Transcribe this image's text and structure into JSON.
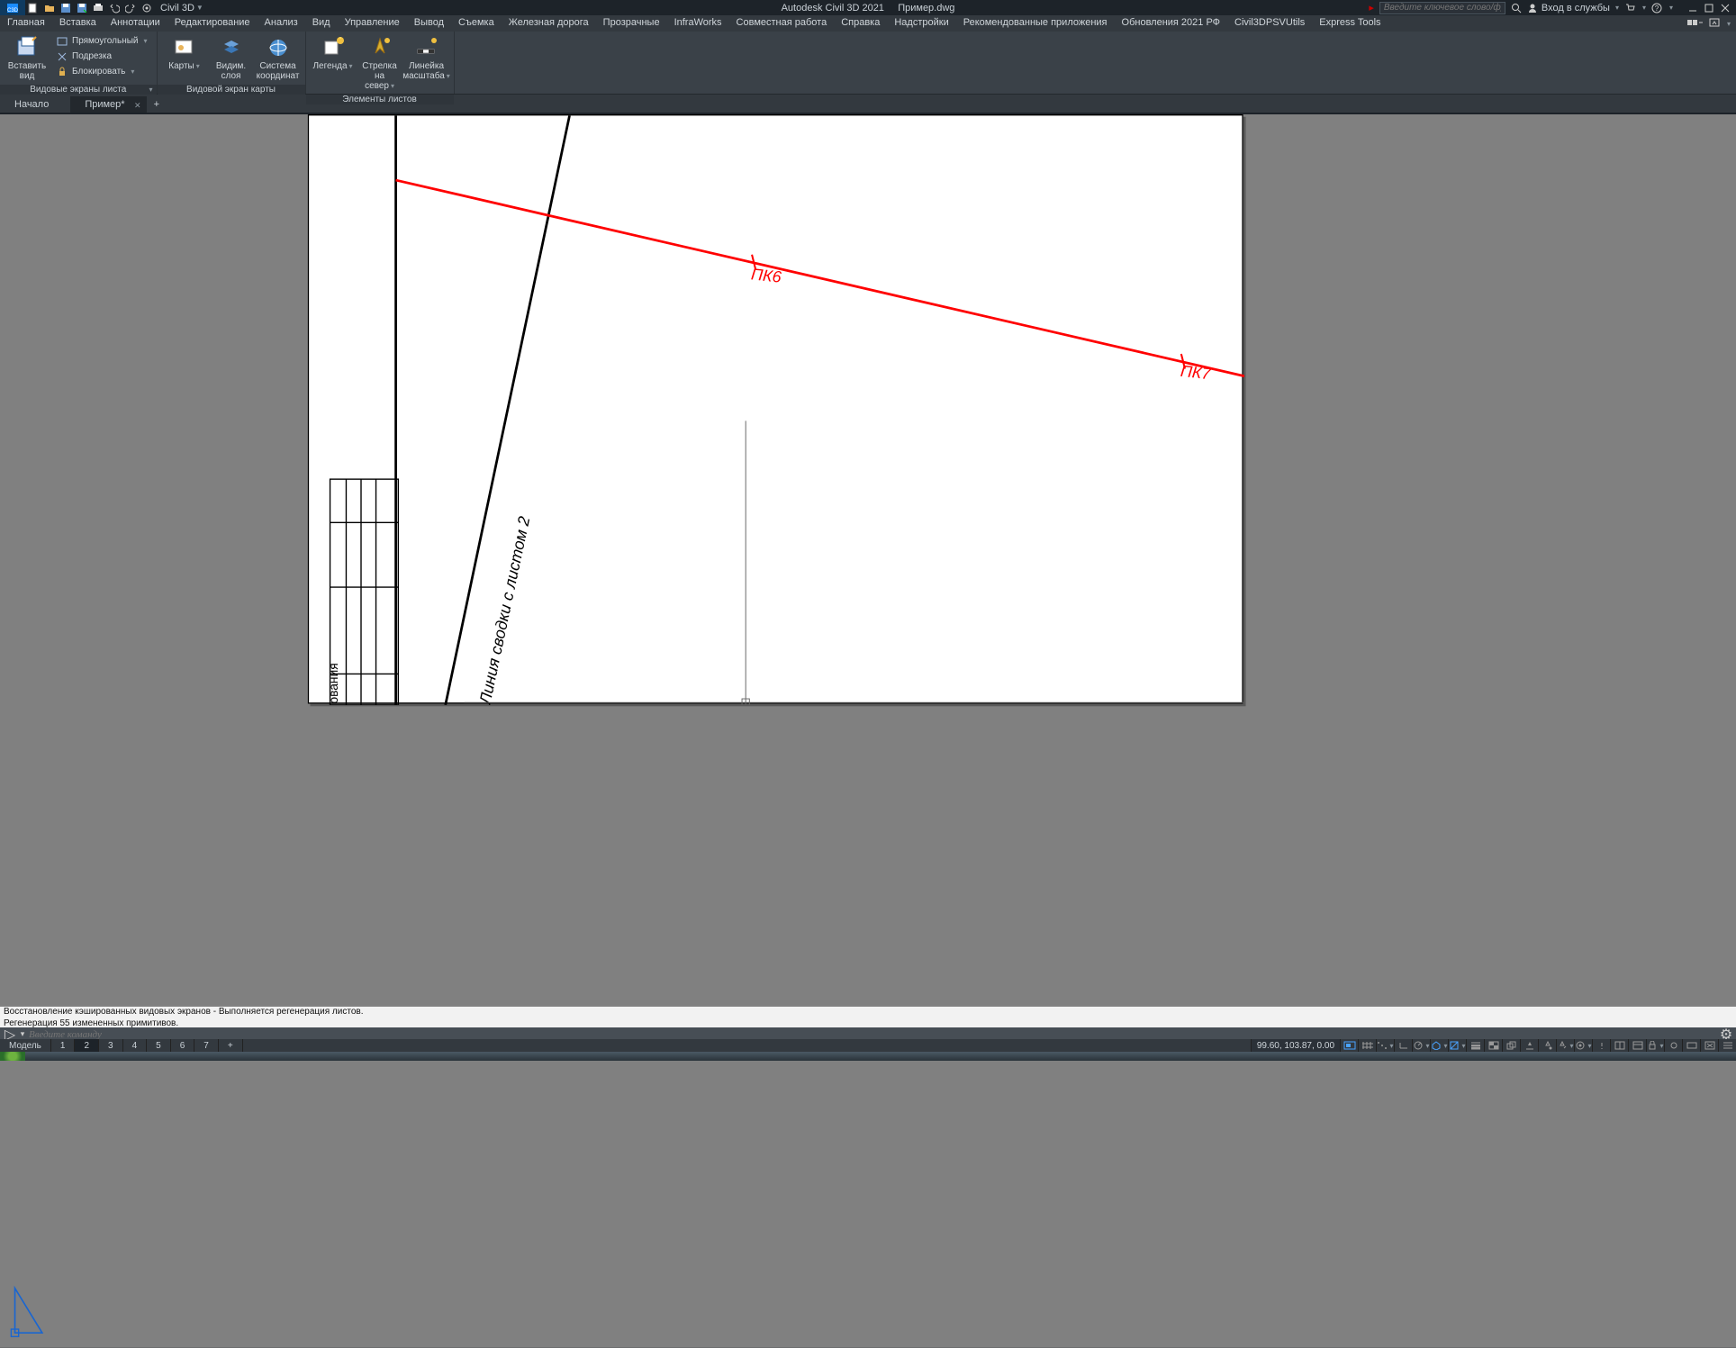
{
  "title": {
    "product": "Autodesk Civil 3D 2021",
    "file": "Пример.dwg",
    "workspace": "Civil 3D"
  },
  "search": {
    "placeholder": "Введите ключевое слово/фразу"
  },
  "signin": {
    "label": "Вход в службы"
  },
  "menu": [
    "Главная",
    "Вставка",
    "Аннотации",
    "Редактирование",
    "Анализ",
    "Вид",
    "Управление",
    "Вывод",
    "Съемка",
    "Железная дорога",
    "Прозрачные",
    "InfraWorks",
    "Совместная работа",
    "Справка",
    "Надстройки",
    "Рекомендованные приложения",
    "Обновления 2021 РФ",
    "Civil3DPSVUtils",
    "Express Tools"
  ],
  "doctabs": {
    "home": "Начало",
    "active": "Пример*",
    "add": "+"
  },
  "ribbon": {
    "panel1": {
      "title": "Видовые экраны листа",
      "big": "Вставить вид",
      "stack": [
        "Прямоугольный",
        "Подрезка",
        "Блокировать"
      ]
    },
    "panel2": {
      "title": "Видовой экран карты",
      "btns": [
        {
          "l1": "Карты",
          "l2": ""
        },
        {
          "l1": "Видим.",
          "l2": "слоя"
        },
        {
          "l1": "Система",
          "l2": "координат"
        }
      ]
    },
    "panel3": {
      "title": "Элементы листов",
      "btns": [
        {
          "l1": "Легенда",
          "l2": ""
        },
        {
          "l1": "Стрелка",
          "l2": "на север"
        },
        {
          "l1": "Линейка",
          "l2": "масштаба"
        }
      ]
    }
  },
  "layouts": {
    "model": "Модель",
    "tabs": [
      "1",
      "2",
      "3",
      "4",
      "5",
      "6",
      "7"
    ],
    "active": "2",
    "add": "+"
  },
  "drawing": {
    "pk6": "ПК6",
    "pk7": "ПК7",
    "matchline": "Линия сводки с листом 2",
    "cond": "ования"
  },
  "cmd": {
    "log1": "Восстановление кэшированных видовых экранов - Выполняется регенерация листов.",
    "log2": "Регенерация 55 измененных примитивов.",
    "placeholder": "Введите команду"
  },
  "status": {
    "coords": "99.60, 103.87, 0.00"
  }
}
